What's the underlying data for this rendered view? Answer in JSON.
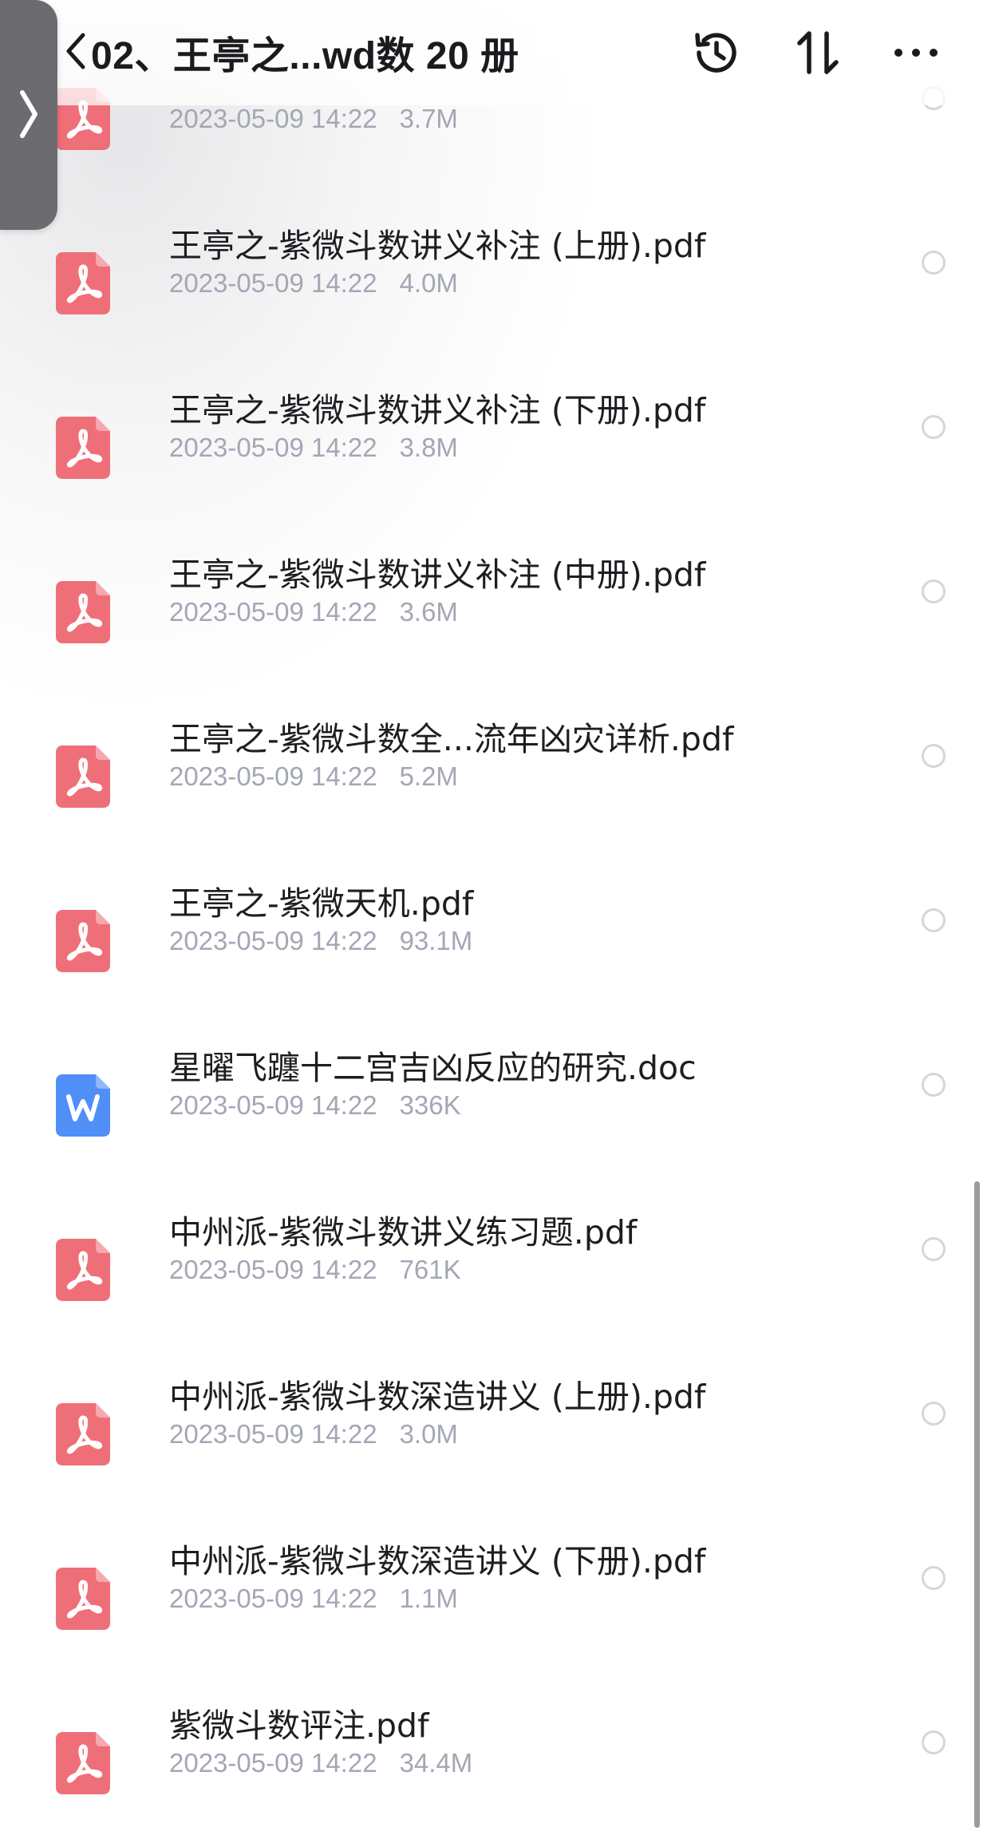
{
  "header": {
    "title": "02、王亭之...wd数 20 册",
    "icons": [
      "back-chevron-icon",
      "history-icon",
      "sort-icon",
      "more-icon"
    ]
  },
  "side_tab": {
    "icon": "chevron-right-icon"
  },
  "files": [
    {
      "name": "",
      "date": "2023-05-09 14:22",
      "size": "3.7M",
      "type": "pdf"
    },
    {
      "name": "王亭之-紫微斗数讲义补注 (上册).pdf",
      "date": "2023-05-09 14:22",
      "size": "4.0M",
      "type": "pdf"
    },
    {
      "name": "王亭之-紫微斗数讲义补注 (下册).pdf",
      "date": "2023-05-09 14:22",
      "size": "3.8M",
      "type": "pdf"
    },
    {
      "name": "王亭之-紫微斗数讲义补注 (中册).pdf",
      "date": "2023-05-09 14:22",
      "size": "3.6M",
      "type": "pdf"
    },
    {
      "name": "王亭之-紫微斗数全...流年凶灾详析.pdf",
      "date": "2023-05-09 14:22",
      "size": "5.2M",
      "type": "pdf"
    },
    {
      "name": "王亭之-紫微天机.pdf",
      "date": "2023-05-09 14:22",
      "size": "93.1M",
      "type": "pdf"
    },
    {
      "name": "星曜飞躔十二宫吉凶反应的研究.doc",
      "date": "2023-05-09 14:22",
      "size": "336K",
      "type": "doc"
    },
    {
      "name": "中州派-紫微斗数讲义练习题.pdf",
      "date": "2023-05-09 14:22",
      "size": "761K",
      "type": "pdf"
    },
    {
      "name": "中州派-紫微斗数深造讲义 (上册).pdf",
      "date": "2023-05-09 14:22",
      "size": "3.0M",
      "type": "pdf"
    },
    {
      "name": "中州派-紫微斗数深造讲义 (下册).pdf",
      "date": "2023-05-09 14:22",
      "size": "1.1M",
      "type": "pdf"
    },
    {
      "name": "紫微斗数评注.pdf",
      "date": "2023-05-09 14:22",
      "size": "34.4M",
      "type": "pdf"
    }
  ],
  "colors": {
    "pdf_icon": "#ef6f78",
    "doc_icon": "#4f8ff7",
    "meta_text": "#a3a7b5",
    "radio_border": "#d4d6dc",
    "side_tab": "#6c6c70"
  }
}
